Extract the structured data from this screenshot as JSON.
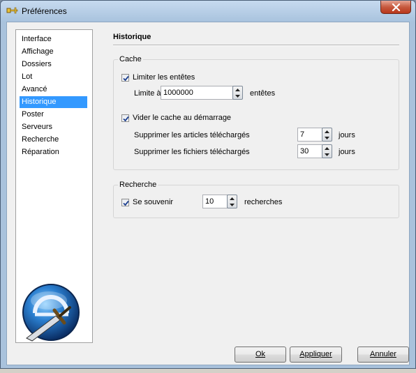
{
  "window": {
    "title": "Préférences"
  },
  "sidebar": {
    "items": [
      {
        "label": "Interface"
      },
      {
        "label": "Affichage"
      },
      {
        "label": "Dossiers"
      },
      {
        "label": "Lot"
      },
      {
        "label": "Avancé"
      },
      {
        "label": "Historique"
      },
      {
        "label": "Poster"
      },
      {
        "label": "Serveurs"
      },
      {
        "label": "Recherche"
      },
      {
        "label": "Réparation"
      }
    ],
    "selected": "Historique"
  },
  "page": {
    "title": "Historique"
  },
  "cache": {
    "legend": "Cache",
    "limit_headers": {
      "label": "Limiter les entêtes",
      "checked": true
    },
    "limit_label": "Limite à",
    "limit_value": "1000000",
    "limit_unit": "entêtes",
    "clear_on_start": {
      "label": "Vider le cache au démarrage",
      "checked": true
    },
    "delete_downloaded_articles": {
      "label": "Supprimer les articles téléchargés",
      "value": "7",
      "unit": "jours"
    },
    "delete_downloaded_files": {
      "label": "Supprimer les fichiers téléchargés",
      "value": "30",
      "unit": "jours"
    }
  },
  "search": {
    "legend": "Recherche",
    "remember": {
      "label": "Se souvenir",
      "checked": true
    },
    "value": "10",
    "unit": "recherches"
  },
  "buttons": {
    "ok": "Ok",
    "apply": "Appliquer",
    "cancel": "Annuler"
  },
  "colors": {
    "selection": "#3399ff",
    "titlebar": "#a9c2dc",
    "close": "#c75a3f"
  },
  "icons": {
    "app": "key-icon",
    "logo": "sword-logo-icon",
    "close": "close-icon"
  }
}
